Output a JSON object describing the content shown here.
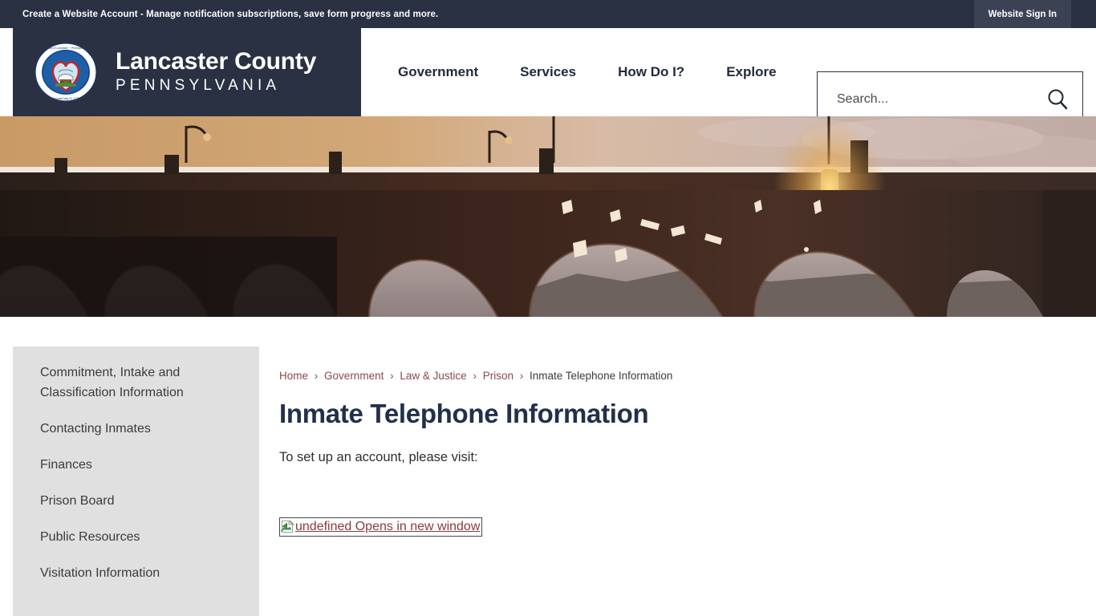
{
  "topbar": {
    "notice": "Create a Website Account - Manage notification subscriptions, save form progress and more.",
    "signin_label": "Website Sign In"
  },
  "header": {
    "logo": {
      "title": "Lancaster County",
      "subtitle": "PENNSYLVANIA",
      "seal_ring_text_top": "County of Lancaster ~ Pennsylvania",
      "seal_ring_text_bottom": "Founded May 10, 1729"
    },
    "nav": [
      {
        "label": "Government"
      },
      {
        "label": "Services"
      },
      {
        "label": "How Do I?"
      },
      {
        "label": "Explore"
      }
    ],
    "search": {
      "placeholder": "Search...",
      "value": "",
      "icon": "search-icon"
    }
  },
  "hero": {
    "alt": "Stone arch bridge silhouetted at sunset over a river",
    "sky_top": "#c89a66",
    "sky_right": "#c6b0a6",
    "bridge": "#3a2a22"
  },
  "sidebar": {
    "items": [
      {
        "label": "Commitment, Intake and Classification Information"
      },
      {
        "label": "Contacting Inmates"
      },
      {
        "label": "Finances"
      },
      {
        "label": "Prison Board"
      },
      {
        "label": "Public Resources"
      },
      {
        "label": "Visitation Information"
      }
    ]
  },
  "main": {
    "breadcrumb": [
      {
        "label": "Home",
        "current": false
      },
      {
        "label": "Government",
        "current": false
      },
      {
        "label": "Law & Justice",
        "current": false
      },
      {
        "label": "Prison",
        "current": false
      },
      {
        "label": "Inmate Telephone Information",
        "current": true
      }
    ],
    "breadcrumb_separator": "›",
    "title": "Inmate Telephone Information",
    "paragraph": "To set up an account, please visit:",
    "broken_image_link": {
      "alt_text": "undefined Opens in new window",
      "icon": "broken-image-icon"
    }
  },
  "colors": {
    "navy": "#2a3142",
    "signin_bg": "#3b4254",
    "sidebar_bg": "#e0e0e0",
    "link_maroon": "#8a4a4a",
    "title_navy": "#22304a"
  }
}
